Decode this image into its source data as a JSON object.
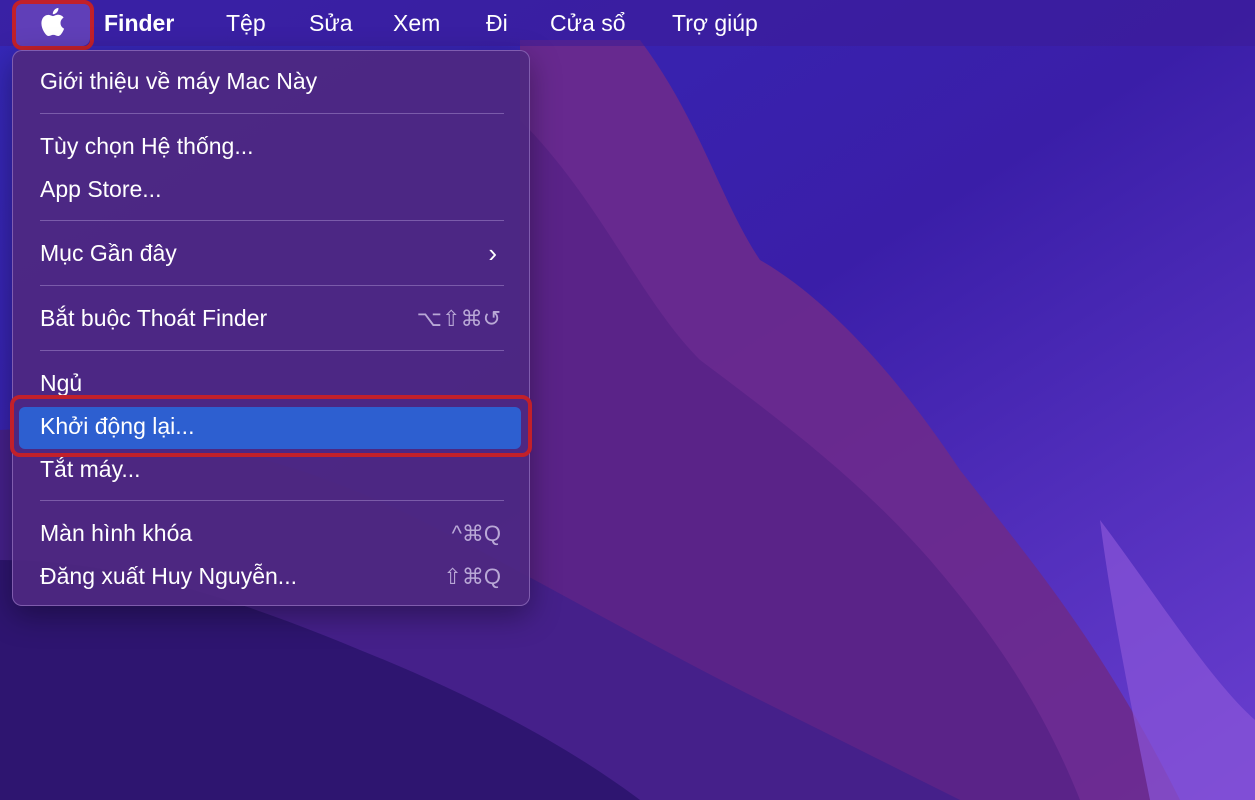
{
  "menubar": {
    "apple_icon": "apple-logo-icon",
    "app_name": "Finder",
    "items": [
      "Tệp",
      "Sửa",
      "Xem",
      "Đi",
      "Cửa sổ",
      "Trợ giúp"
    ]
  },
  "apple_menu": {
    "about": "Giới thiệu về máy Mac Này",
    "system_prefs": "Tùy chọn Hệ thống...",
    "app_store": "App Store...",
    "recent_items": "Mục Gần đây",
    "force_quit": "Bắt buộc Thoát Finder",
    "force_quit_shortcut": "⌥⇧⌘↺",
    "sleep": "Ngủ",
    "restart": "Khởi động lại...",
    "shutdown": "Tắt máy...",
    "lock_screen": "Màn hình khóa",
    "lock_screen_shortcut": "^⌘Q",
    "logout": "Đăng xuất Huy Nguyễn...",
    "logout_shortcut": "⇧⌘Q"
  },
  "colors": {
    "highlight_box": "#c2202a",
    "selected_item": "#2d5fd0"
  }
}
